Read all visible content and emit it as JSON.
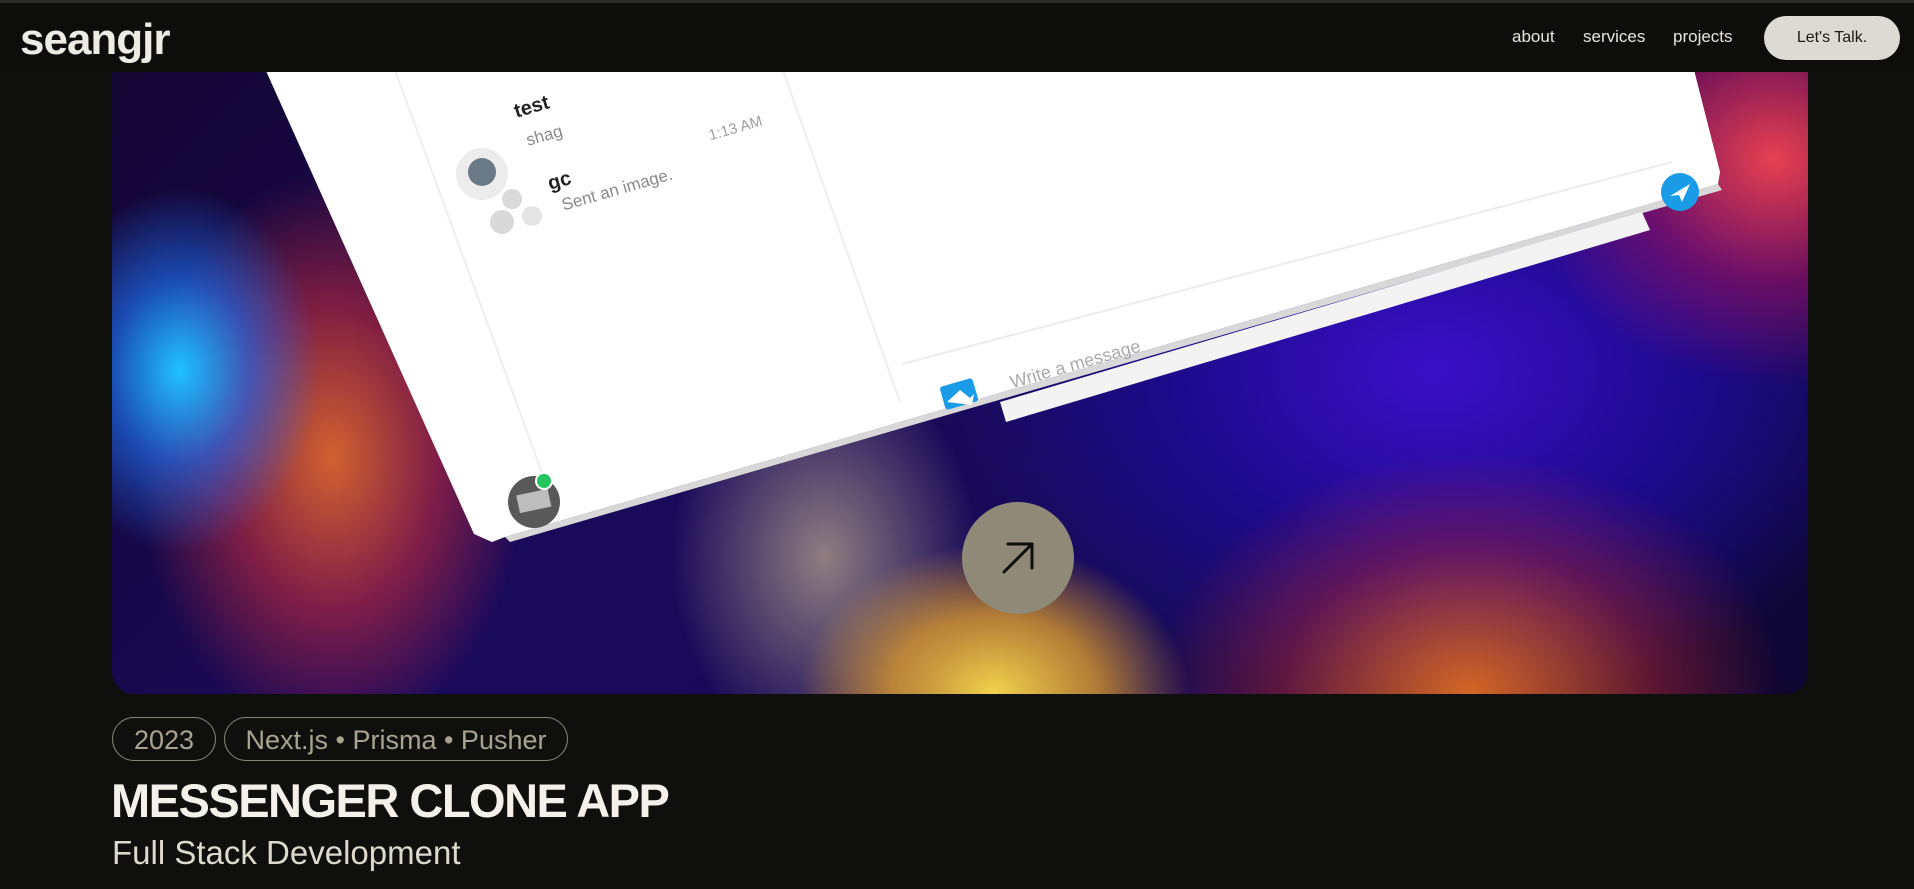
{
  "header": {
    "logo": "seangjr",
    "nav": {
      "about": "about",
      "services": "services",
      "projects": "projects"
    },
    "cta": "Let's Talk."
  },
  "preview": {
    "conversations": [
      {
        "name": "test",
        "last_message": "shag",
        "time": "1:13 AM"
      },
      {
        "name": "gc",
        "last_message": "Sent an image.",
        "time": ""
      }
    ],
    "message_placeholder": "Write a message",
    "icons": [
      "image-icon",
      "send-icon",
      "avatar",
      "arrow-up-right-icon"
    ]
  },
  "project": {
    "year": "2023",
    "tech": "Next.js • Prisma • Pusher",
    "title": "MESSENGER CLONE APP",
    "subtitle": "Full Stack Development"
  },
  "colors": {
    "background": "#0f0f0d",
    "cta_bg": "#dcdbd3",
    "arrow_button": "#8f8a77",
    "send_accent": "#1a9be8",
    "online": "#22c55e"
  }
}
